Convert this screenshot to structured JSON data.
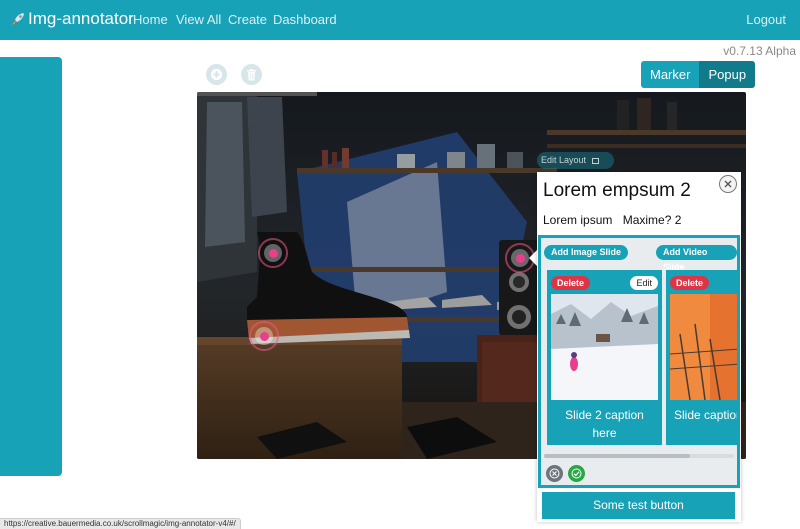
{
  "navbar": {
    "brand": "Img-annotator",
    "links": [
      "Home",
      "View All",
      "Create",
      "Dashboard"
    ],
    "logout": "Logout",
    "color": "#17a2b8"
  },
  "version": "v0.7.13 Alpha",
  "toolbar": {
    "add_icon": "plus-circle-icon",
    "delete_icon": "trash-icon"
  },
  "mode_toggle": {
    "marker": "Marker",
    "popup": "Popup",
    "active": "Popup"
  },
  "stage": {
    "edit_layout": "Edit Layout"
  },
  "popup": {
    "title": "Lorem empsum 2",
    "text_a": "Lorem ipsum",
    "text_b": "Maxime? 2",
    "add_image_slide": "Add Image Slide",
    "add_video_slide": "Add Video Slide",
    "slides": [
      {
        "delete": "Delete",
        "edit": "Edit",
        "caption": "Slide 2 caption here"
      },
      {
        "delete": "Delete",
        "caption": "Slide caption"
      }
    ],
    "test_button": "Some test button"
  },
  "status_bar": {
    "url": "https://creative.bauermedia.co.uk/scrollmagic/img-annotator-v4/#/"
  }
}
